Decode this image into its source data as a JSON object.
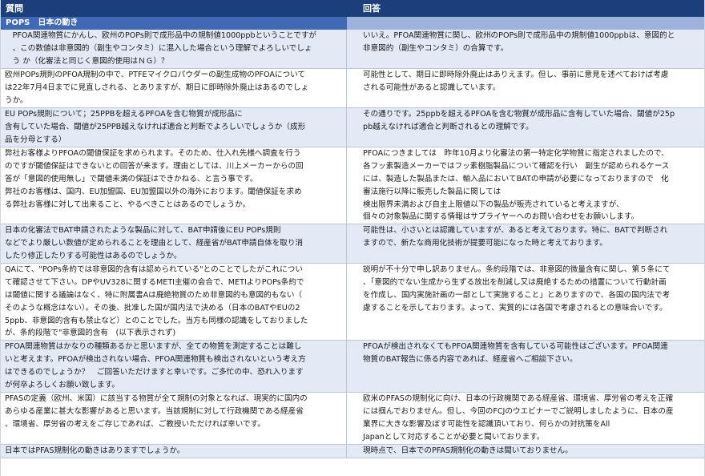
{
  "header": {
    "question": "質問",
    "answer": "回答"
  },
  "section": {
    "title": "POPS　日本の動き"
  },
  "rows": [
    {
      "q": [
        "　PFOA関連物質にかんし、欧州のPOPs則で成形品中の規制値1000ppbということですが",
        "　、この数値は非意図的（副生やコンタミ）に混入した場合という理解でよろしいでしょ",
        "　う か（化審法と同じく意図的使用はＮＧ）？"
      ],
      "a": [
        "いいえ。PFOA関連物質に関し、欧州のPOPs則で成形品中の規制値1000ppbは、意図的と",
        "非意図的（副生やコンタミ）の合算です。"
      ]
    },
    {
      "q": [
        "欧州POPs規則のPFOA規制の中で、PTFEマイクロパウダーの副生成物のPFOAについて",
        "は22年7月4日までに見直しされる、とありますが、期日に即時除外廃止はあるのでしょ",
        "うか。"
      ],
      "a": [
        "可能性として、期日に即時除外廃止はありえます。但し、事前に意見を述べておけば考慮",
        "される可能性があると認識しています。"
      ]
    },
    {
      "q": [
        "EU POPs規則について；25PPBを超えるPFOAを含む物質が成形品に",
        "含有していた場合、閾値が25PPB越えなければ適合と判断でよろしいでしょうか（成形",
        "品を分母とする）"
      ],
      "a": [
        "その通りです。25ppbを超えるPFOAを含む物質が成形品に含有していた場合、閾値が25p",
        "pb越えなければ適合と判断されるとの理解です。"
      ]
    },
    {
      "q": [
        "弊社お客様よりPFOAの閾値保証を求められます。そのため、仕入れ先様へ調査を行う",
        "のですが閾値保証はできないとの回答が来ます。理由としては、川上メーカーからの回",
        "答が「意図的使用無し」で閾値未満の保証はできかねる、と言う事です。",
        "弊社のお客様は、国内、EU加盟国、EU加盟国以外の海外におります。閾値保証を求め",
        "る弊社お客様に対して出来ること、やるべきことはあるのでしょうか。",
        ""
      ],
      "a": [
        "PFOAにつきましては　昨年10月より化審法の第一特定化学物質に指定されましたので、",
        "各フッ素製造メーカーではフッ素樹脂製品について確認を行い　副生が認められるケース",
        "には、製造した製品または、輸入品においてBATの申請が必要になっておりますので　化",
        "審法施行以降に販売した製品に関しては",
        "検出限界未満および自主上限値以下の製品が販売されていると考えますが、",
        "個々の対象製品に関する情報はサプライヤーへのお問い合わせをお願いします。"
      ]
    },
    {
      "q": [
        "日本の化審法でBAT申請されたような製品に対して、BAT申請後にEU POPs規則",
        "などでより厳しい数値が定められることを理由として、経産省がBAT申請自体を取り消",
        "したり修正したりする可能性はあるのでしょうか。"
      ],
      "a": [
        "可能性は、小さいとは認識していますが、あると考えております。特に、BATで判断され",
        "ますので、新たな商用化技術が提要可能になった時と考えております。"
      ]
    },
    {
      "q": [
        "QAにて、\"POPs条約では非意図的含有は認められている\"とのことでしたがこれについ",
        "て確認させて下さい。DPやUV328に関するMETI主催の会合で、METIよりPOPs条約で",
        "は閾値に関する議論はなく、特に附属書Aは廃絶物質のため非意図的も意図的もない（",
        "そのような概念はない）。その後、批准した国が国内法で決める（日本のBATやEUの2",
        "5ppb、非意図的含有も禁止など）とのことでした。当方も同様の認識をしておりました",
        "が、条約段階で\"非意図的含有　(以下表示されず)"
      ],
      "a": [
        "説明が不十分で申し訳ありません。条約段階では、非意図的微量含有に関し、第５条にて",
        "、「意図的でない生成から生ずる放出を削減し又は廃絶するための措置について行動計画",
        "を作成し、国内実施計画の一部として実施すること」とありますので、各国の国内法で考",
        "慮することを示しております。よって、実質的には各国で考慮されるとの意味合いです。",
        "",
        ""
      ]
    },
    {
      "q": [
        "PFOA関連物質はかなりの種類あるかと思いますが、全ての物質を測定することは難し",
        "いと考えます。PFOAが検出されない場合、PFOA関連物質も検出されないという考え方",
        "はできるのでしょうか？　ご回答いただけますと幸いです。ご多忙の中、恐れ入ります",
        "が何卒よろしくお願い致します。"
      ],
      "a": [
        "PFOAが検出されなくてもPFOA関連物質を含有している可能性はございます。PFOA関連",
        "物質のBAT報告に係る内容であれば、経産省へご相談下さい。"
      ]
    },
    {
      "q": [
        "PFASの定義（欧州、米国）に該当する物質が全て規制の対象となれば、現実的に国内の",
        "あらゆる産業に甚大な影響があると思います。当該規制に対して行政機関である経産省",
        "、環境省、厚労省の考えをご存じであれば、ご教授いただければ幸いです。",
        ""
      ],
      "a": [
        "欧米のPFASの規制化に向け、日本の行政機関である経産省、環境省、厚労省の考えを正確",
        "には掴んでおりません。但し、今回のFCJのウエビナーでご説明しましたように、日本の産",
        "業界に大きな影響及ぼす可能性を認識頂いており、何らかの対抗策をAll",
        "Japanとして対応することが必要と聞いております。"
      ]
    },
    {
      "q": [
        "日本ではPFAS規制化の動きはありますでしょうか。"
      ],
      "a": [
        "現時点で、日本でのPFAS規制化の動きは聞いておりません。"
      ]
    }
  ]
}
